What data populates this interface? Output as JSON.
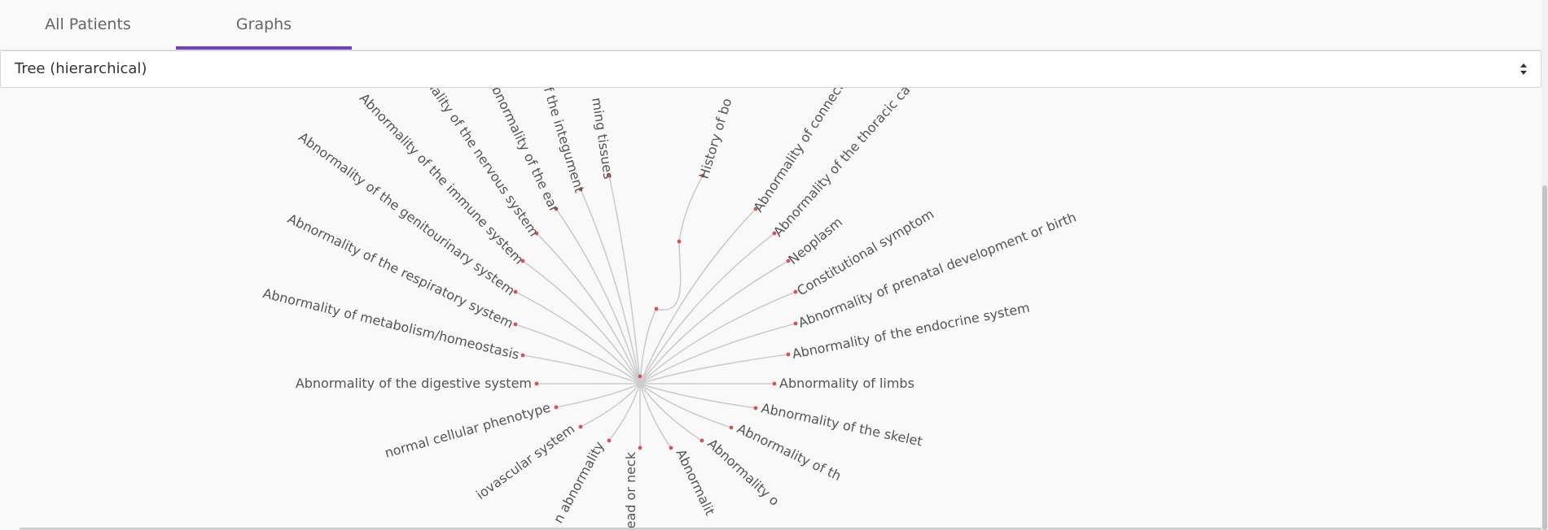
{
  "tabs": [
    {
      "label": "All Patients",
      "active": false
    },
    {
      "label": "Graphs",
      "active": true
    }
  ],
  "graph_type_select": {
    "value": "Tree (hierarchical)"
  },
  "tree": {
    "line_color": "#cccccc",
    "node_color": "#d9534f",
    "tab_accent_color": "#6a3fd2",
    "hidden_root_label": "",
    "history_child_label": "History of bo",
    "labels_left": [
      "ming tissues",
      "f the integument",
      "Abnormality of the ear",
      "Abnormality of the nervous system",
      "Abnormality of the immune system",
      "Abnormality of the genitourinary system",
      "Abnormality of the respiratory system",
      "Abnormality of metabolism/homeostasis",
      "Abnormality of the digestive system",
      "normal cellular phenotype",
      "iovascular system",
      "n abnormality",
      "ead or neck"
    ],
    "labels_right": [
      "Abnormality of connective",
      "Abnormality of the thoracic cavity",
      "Neoplasm",
      "Constitutional symptom",
      "Abnormality of prenatal development or birth",
      "Abnormality of the endocrine system",
      "Abnormality of limbs",
      "Abnormality of the skelet",
      "Abnormality of th",
      "Abnormality o",
      "Abnormalit"
    ]
  }
}
